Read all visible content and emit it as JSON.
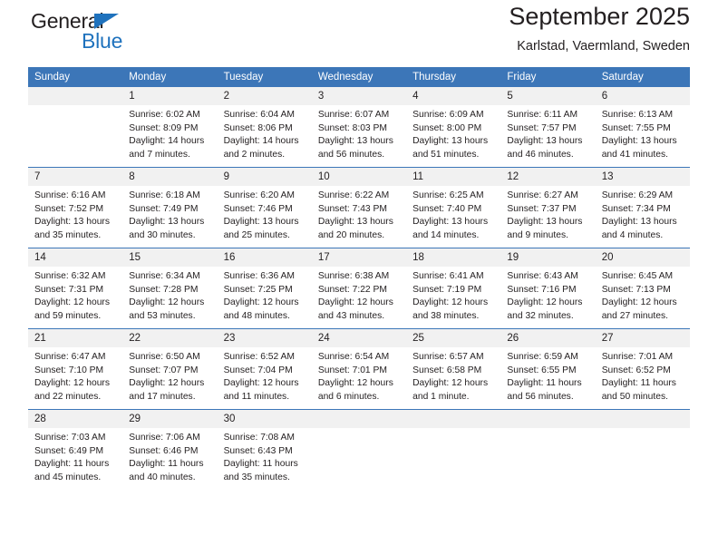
{
  "brand": {
    "name_top": "General",
    "name_bottom": "Blue",
    "accent_color": "#1f72bd"
  },
  "header": {
    "title": "September 2025",
    "subtitle": "Karlstad, Vaermland, Sweden"
  },
  "theme": {
    "header_blue": "#3c76b8",
    "daynum_gray": "#f1f1f1",
    "text": "#231f20"
  },
  "calendar": {
    "weekday_headers": [
      "Sunday",
      "Monday",
      "Tuesday",
      "Wednesday",
      "Thursday",
      "Friday",
      "Saturday"
    ],
    "weeks": [
      [
        {
          "day": "",
          "blank": true,
          "sunrise": "",
          "sunset": "",
          "daylight1": "",
          "daylight2": ""
        },
        {
          "day": "1",
          "blank": false,
          "sunrise": "Sunrise: 6:02 AM",
          "sunset": "Sunset: 8:09 PM",
          "daylight1": "Daylight: 14 hours",
          "daylight2": "and 7 minutes."
        },
        {
          "day": "2",
          "blank": false,
          "sunrise": "Sunrise: 6:04 AM",
          "sunset": "Sunset: 8:06 PM",
          "daylight1": "Daylight: 14 hours",
          "daylight2": "and 2 minutes."
        },
        {
          "day": "3",
          "blank": false,
          "sunrise": "Sunrise: 6:07 AM",
          "sunset": "Sunset: 8:03 PM",
          "daylight1": "Daylight: 13 hours",
          "daylight2": "and 56 minutes."
        },
        {
          "day": "4",
          "blank": false,
          "sunrise": "Sunrise: 6:09 AM",
          "sunset": "Sunset: 8:00 PM",
          "daylight1": "Daylight: 13 hours",
          "daylight2": "and 51 minutes."
        },
        {
          "day": "5",
          "blank": false,
          "sunrise": "Sunrise: 6:11 AM",
          "sunset": "Sunset: 7:57 PM",
          "daylight1": "Daylight: 13 hours",
          "daylight2": "and 46 minutes."
        },
        {
          "day": "6",
          "blank": false,
          "sunrise": "Sunrise: 6:13 AM",
          "sunset": "Sunset: 7:55 PM",
          "daylight1": "Daylight: 13 hours",
          "daylight2": "and 41 minutes."
        }
      ],
      [
        {
          "day": "7",
          "blank": false,
          "sunrise": "Sunrise: 6:16 AM",
          "sunset": "Sunset: 7:52 PM",
          "daylight1": "Daylight: 13 hours",
          "daylight2": "and 35 minutes."
        },
        {
          "day": "8",
          "blank": false,
          "sunrise": "Sunrise: 6:18 AM",
          "sunset": "Sunset: 7:49 PM",
          "daylight1": "Daylight: 13 hours",
          "daylight2": "and 30 minutes."
        },
        {
          "day": "9",
          "blank": false,
          "sunrise": "Sunrise: 6:20 AM",
          "sunset": "Sunset: 7:46 PM",
          "daylight1": "Daylight: 13 hours",
          "daylight2": "and 25 minutes."
        },
        {
          "day": "10",
          "blank": false,
          "sunrise": "Sunrise: 6:22 AM",
          "sunset": "Sunset: 7:43 PM",
          "daylight1": "Daylight: 13 hours",
          "daylight2": "and 20 minutes."
        },
        {
          "day": "11",
          "blank": false,
          "sunrise": "Sunrise: 6:25 AM",
          "sunset": "Sunset: 7:40 PM",
          "daylight1": "Daylight: 13 hours",
          "daylight2": "and 14 minutes."
        },
        {
          "day": "12",
          "blank": false,
          "sunrise": "Sunrise: 6:27 AM",
          "sunset": "Sunset: 7:37 PM",
          "daylight1": "Daylight: 13 hours",
          "daylight2": "and 9 minutes."
        },
        {
          "day": "13",
          "blank": false,
          "sunrise": "Sunrise: 6:29 AM",
          "sunset": "Sunset: 7:34 PM",
          "daylight1": "Daylight: 13 hours",
          "daylight2": "and 4 minutes."
        }
      ],
      [
        {
          "day": "14",
          "blank": false,
          "sunrise": "Sunrise: 6:32 AM",
          "sunset": "Sunset: 7:31 PM",
          "daylight1": "Daylight: 12 hours",
          "daylight2": "and 59 minutes."
        },
        {
          "day": "15",
          "blank": false,
          "sunrise": "Sunrise: 6:34 AM",
          "sunset": "Sunset: 7:28 PM",
          "daylight1": "Daylight: 12 hours",
          "daylight2": "and 53 minutes."
        },
        {
          "day": "16",
          "blank": false,
          "sunrise": "Sunrise: 6:36 AM",
          "sunset": "Sunset: 7:25 PM",
          "daylight1": "Daylight: 12 hours",
          "daylight2": "and 48 minutes."
        },
        {
          "day": "17",
          "blank": false,
          "sunrise": "Sunrise: 6:38 AM",
          "sunset": "Sunset: 7:22 PM",
          "daylight1": "Daylight: 12 hours",
          "daylight2": "and 43 minutes."
        },
        {
          "day": "18",
          "blank": false,
          "sunrise": "Sunrise: 6:41 AM",
          "sunset": "Sunset: 7:19 PM",
          "daylight1": "Daylight: 12 hours",
          "daylight2": "and 38 minutes."
        },
        {
          "day": "19",
          "blank": false,
          "sunrise": "Sunrise: 6:43 AM",
          "sunset": "Sunset: 7:16 PM",
          "daylight1": "Daylight: 12 hours",
          "daylight2": "and 32 minutes."
        },
        {
          "day": "20",
          "blank": false,
          "sunrise": "Sunrise: 6:45 AM",
          "sunset": "Sunset: 7:13 PM",
          "daylight1": "Daylight: 12 hours",
          "daylight2": "and 27 minutes."
        }
      ],
      [
        {
          "day": "21",
          "blank": false,
          "sunrise": "Sunrise: 6:47 AM",
          "sunset": "Sunset: 7:10 PM",
          "daylight1": "Daylight: 12 hours",
          "daylight2": "and 22 minutes."
        },
        {
          "day": "22",
          "blank": false,
          "sunrise": "Sunrise: 6:50 AM",
          "sunset": "Sunset: 7:07 PM",
          "daylight1": "Daylight: 12 hours",
          "daylight2": "and 17 minutes."
        },
        {
          "day": "23",
          "blank": false,
          "sunrise": "Sunrise: 6:52 AM",
          "sunset": "Sunset: 7:04 PM",
          "daylight1": "Daylight: 12 hours",
          "daylight2": "and 11 minutes."
        },
        {
          "day": "24",
          "blank": false,
          "sunrise": "Sunrise: 6:54 AM",
          "sunset": "Sunset: 7:01 PM",
          "daylight1": "Daylight: 12 hours",
          "daylight2": "and 6 minutes."
        },
        {
          "day": "25",
          "blank": false,
          "sunrise": "Sunrise: 6:57 AM",
          "sunset": "Sunset: 6:58 PM",
          "daylight1": "Daylight: 12 hours",
          "daylight2": "and 1 minute."
        },
        {
          "day": "26",
          "blank": false,
          "sunrise": "Sunrise: 6:59 AM",
          "sunset": "Sunset: 6:55 PM",
          "daylight1": "Daylight: 11 hours",
          "daylight2": "and 56 minutes."
        },
        {
          "day": "27",
          "blank": false,
          "sunrise": "Sunrise: 7:01 AM",
          "sunset": "Sunset: 6:52 PM",
          "daylight1": "Daylight: 11 hours",
          "daylight2": "and 50 minutes."
        }
      ],
      [
        {
          "day": "28",
          "blank": false,
          "sunrise": "Sunrise: 7:03 AM",
          "sunset": "Sunset: 6:49 PM",
          "daylight1": "Daylight: 11 hours",
          "daylight2": "and 45 minutes."
        },
        {
          "day": "29",
          "blank": false,
          "sunrise": "Sunrise: 7:06 AM",
          "sunset": "Sunset: 6:46 PM",
          "daylight1": "Daylight: 11 hours",
          "daylight2": "and 40 minutes."
        },
        {
          "day": "30",
          "blank": false,
          "sunrise": "Sunrise: 7:08 AM",
          "sunset": "Sunset: 6:43 PM",
          "daylight1": "Daylight: 11 hours",
          "daylight2": "and 35 minutes."
        },
        {
          "day": "",
          "blank": true,
          "sunrise": "",
          "sunset": "",
          "daylight1": "",
          "daylight2": ""
        },
        {
          "day": "",
          "blank": true,
          "sunrise": "",
          "sunset": "",
          "daylight1": "",
          "daylight2": ""
        },
        {
          "day": "",
          "blank": true,
          "sunrise": "",
          "sunset": "",
          "daylight1": "",
          "daylight2": ""
        },
        {
          "day": "",
          "blank": true,
          "sunrise": "",
          "sunset": "",
          "daylight1": "",
          "daylight2": ""
        }
      ]
    ]
  }
}
